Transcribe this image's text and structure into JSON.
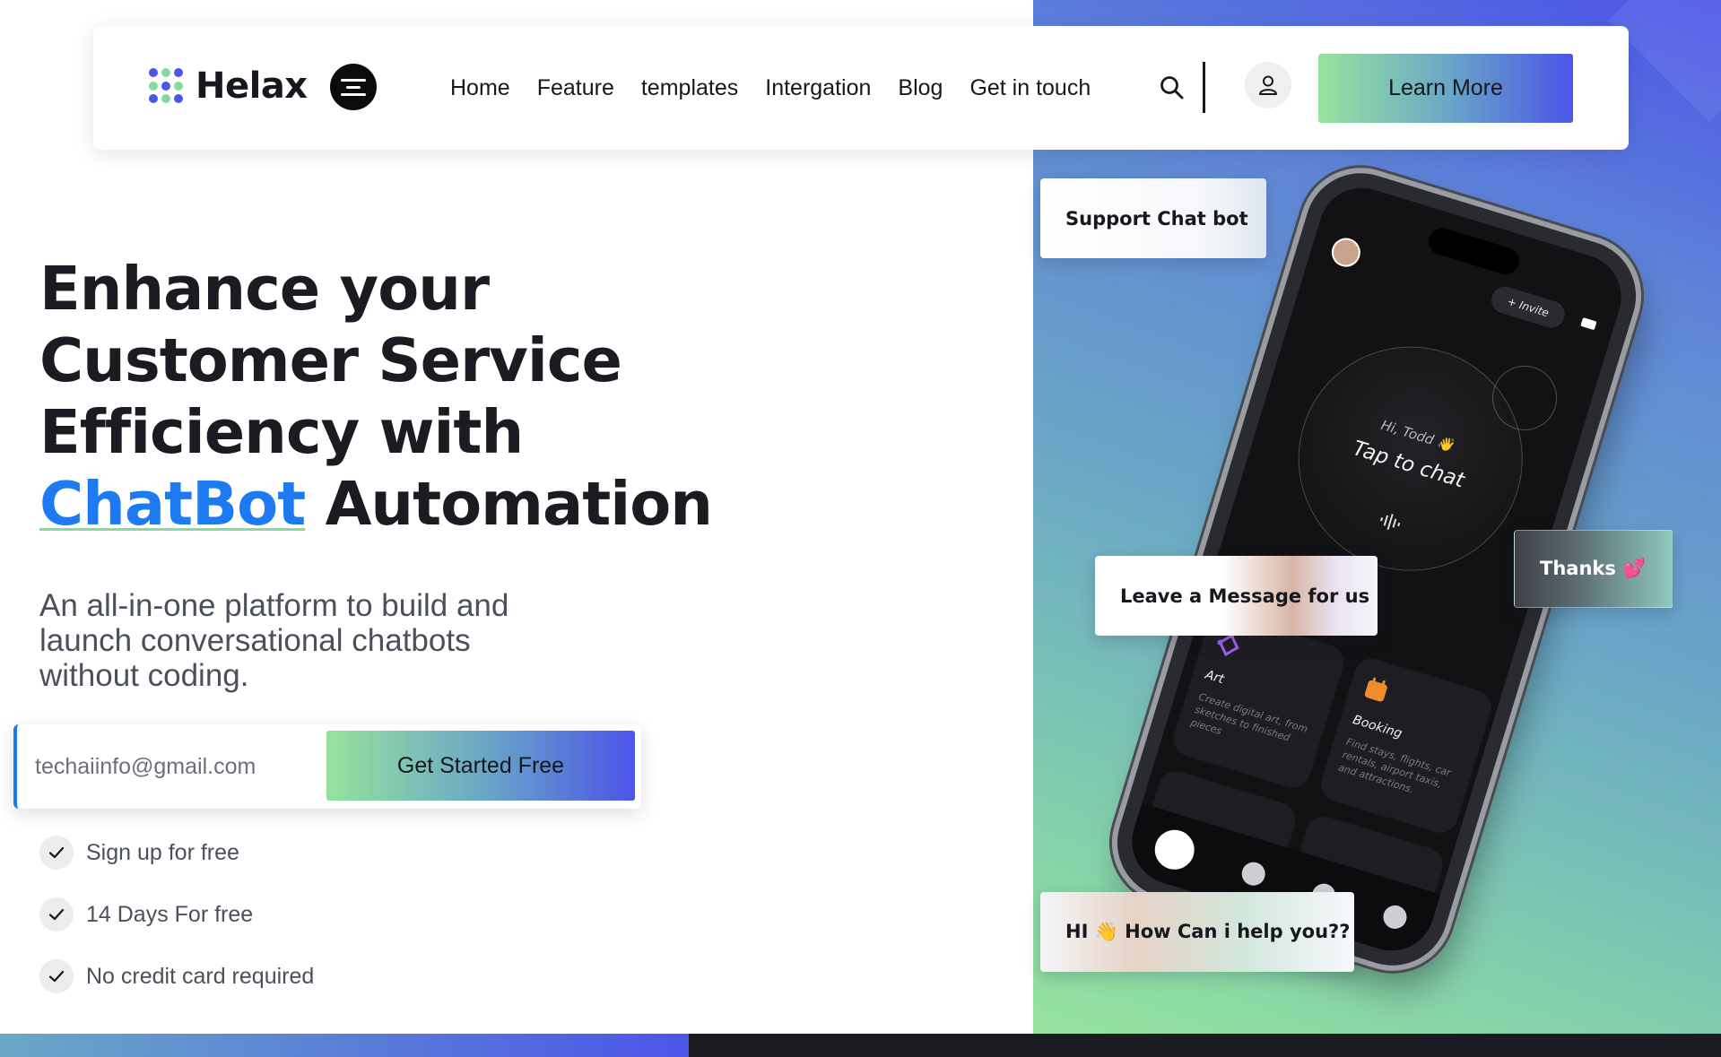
{
  "brand": {
    "name": "Helax",
    "accent": "#4b55e8",
    "secondary": "#95e39c",
    "link_blue": "#1e7af0"
  },
  "nav": {
    "links": [
      "Home",
      "Feature",
      "templates",
      "Intergation",
      "Blog",
      "Get in touch"
    ],
    "cta_label": "Learn More",
    "icons": {
      "search": "search-icon",
      "user": "user-icon",
      "menu": "hamburger-menu-icon"
    }
  },
  "hero": {
    "title_line1": "Enhance your",
    "title_line2": "Customer Service",
    "title_line3": "Efficiency with",
    "title_accent": "ChatBot",
    "title_end": "Automation",
    "subtitle": "An all-in-one platform to build and launch conversational chatbots without coding."
  },
  "signup": {
    "email_placeholder": "techaiinfo@gmail.com",
    "button_label": "Get Started Free"
  },
  "features": [
    "Sign up for free",
    "14 Days For free",
    "No credit card required"
  ],
  "phone": {
    "invite_label": "+ Invite",
    "greeting": "Hi, Todd 👋",
    "tap_label": "Tap to chat",
    "cards": [
      {
        "title": "Art",
        "desc": "Create digital art, from sketches to finished pieces"
      },
      {
        "title": "Booking",
        "desc": "Find stays, flights, car rentals, airport taxis, and attractions."
      }
    ]
  },
  "floating_cards": {
    "support": "Support Chat bot",
    "leave": "Leave a Message for us",
    "thanks": "Thanks 💕",
    "hi": "HI 👋 How Can i help you??"
  }
}
